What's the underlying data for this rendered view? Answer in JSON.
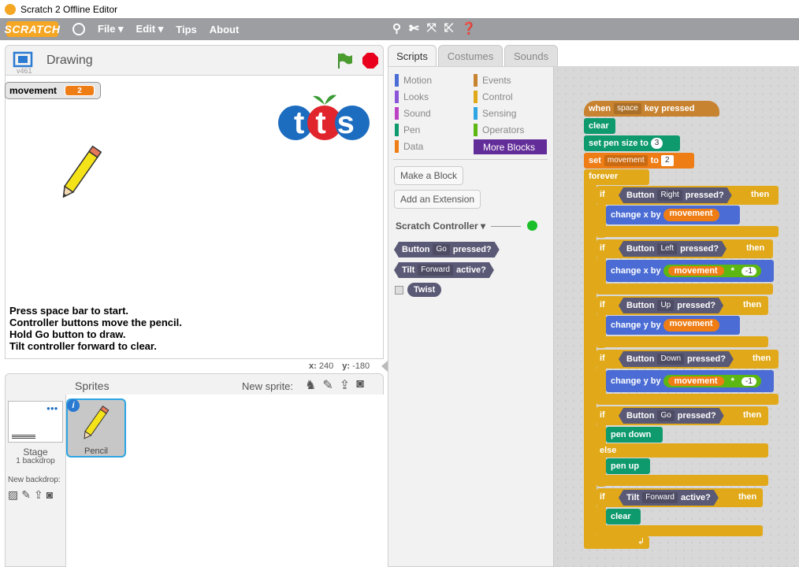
{
  "window": {
    "title": "Scratch 2 Offline Editor"
  },
  "menu": {
    "logo": "SCRATCH",
    "items": [
      "File ▾",
      "Edit ▾",
      "Tips",
      "About"
    ]
  },
  "stage": {
    "version": "v461",
    "project_name": "Drawing",
    "variable_name": "movement",
    "variable_value": "2",
    "logo_text": "tts",
    "instructions": [
      "Press space bar to start.",
      "Controller buttons move the pencil.",
      "Hold Go button to draw.",
      "Tilt controller forward to clear."
    ],
    "x_label": "x:",
    "x_value": "240",
    "y_label": "y:",
    "y_value": "-180"
  },
  "sprites": {
    "title": "Sprites",
    "new_sprite_label": "New sprite:",
    "stage_label": "Stage",
    "stage_backdrops": "1 backdrop",
    "new_backdrop_label": "New backdrop:",
    "sprite_name": "Pencil"
  },
  "tabs": [
    "Scripts",
    "Costumes",
    "Sounds"
  ],
  "categories": [
    {
      "label": "Motion",
      "color": "#4a6cd4"
    },
    {
      "label": "Events",
      "color": "#c88330"
    },
    {
      "label": "Looks",
      "color": "#8a55d7"
    },
    {
      "label": "Control",
      "color": "#e1a91a"
    },
    {
      "label": "Sound",
      "color": "#bb42c3"
    },
    {
      "label": "Sensing",
      "color": "#2ca5e2"
    },
    {
      "label": "Pen",
      "color": "#0e9a6c"
    },
    {
      "label": "Operators",
      "color": "#5cb712"
    },
    {
      "label": "Data",
      "color": "#ee7d16"
    },
    {
      "label": "More Blocks",
      "color": "#632d99"
    }
  ],
  "palette": {
    "make_block": "Make a Block",
    "add_extension": "Add an Extension",
    "extension_name": "Scratch Controller ▾",
    "blocks": [
      {
        "pre": "Button",
        "dd": "Go",
        "post": "pressed?"
      },
      {
        "pre": "Tilt",
        "dd": "Forward",
        "post": "active?"
      },
      {
        "pre": "Twist",
        "dd": "",
        "post": ""
      }
    ]
  },
  "script": {
    "hat": {
      "pre": "when",
      "dd": "space",
      "post": "key pressed"
    },
    "clear": "clear",
    "pen_size": {
      "label": "set pen size to",
      "value": "3"
    },
    "set_var": {
      "pre": "set",
      "dd": "movement",
      "mid": "to",
      "value": "2"
    },
    "forever": "forever",
    "if_label": "if",
    "then_label": "then",
    "else_label": "else",
    "ifs": [
      {
        "pre": "Button",
        "dd": "Right",
        "post": "pressed?",
        "action": "change x by",
        "var": "movement",
        "mul": ""
      },
      {
        "pre": "Button",
        "dd": "Left",
        "post": "pressed?",
        "action": "change x by",
        "var": "movement",
        "mul": "-1"
      },
      {
        "pre": "Button",
        "dd": "Up",
        "post": "pressed?",
        "action": "change y by",
        "var": "movement",
        "mul": ""
      },
      {
        "pre": "Button",
        "dd": "Down",
        "post": "pressed?",
        "action": "change y by",
        "var": "movement",
        "mul": "-1"
      }
    ],
    "go_if": {
      "pre": "Button",
      "dd": "Go",
      "post": "pressed?",
      "then_action": "pen down",
      "else_action": "pen up"
    },
    "tilt_if": {
      "pre": "Tilt",
      "dd": "Forward",
      "post": "active?",
      "action": "clear"
    },
    "mul_sign": "*"
  }
}
